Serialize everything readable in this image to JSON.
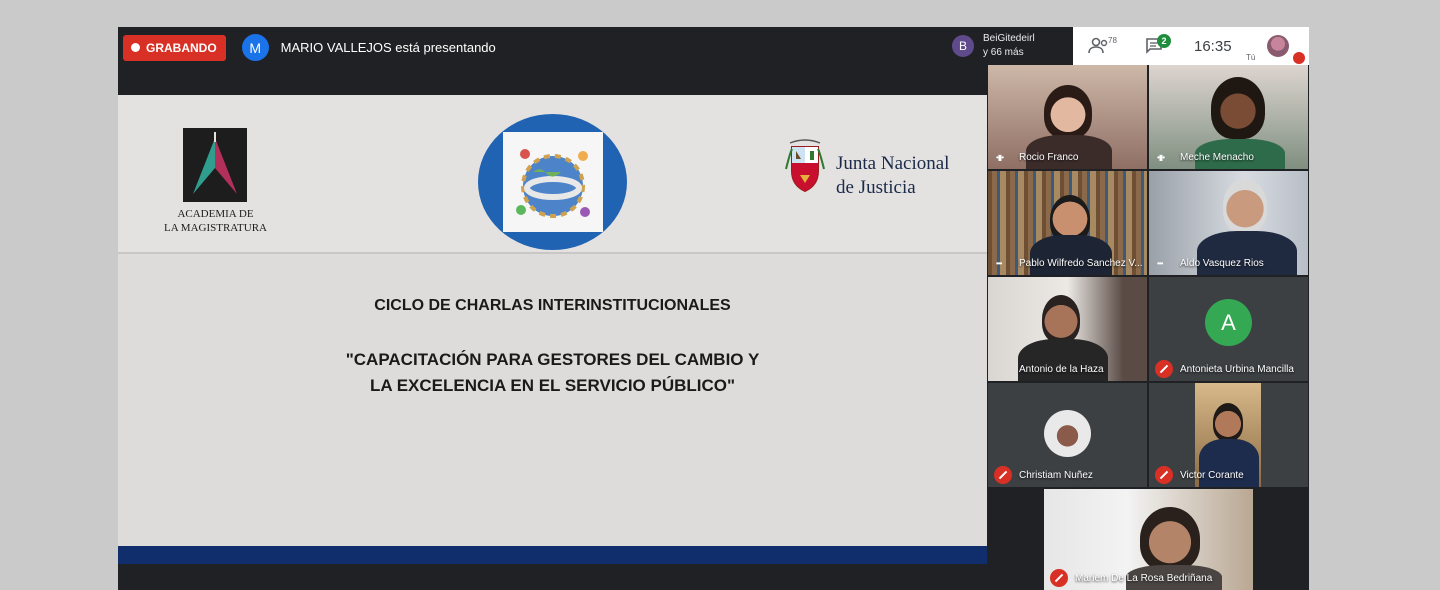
{
  "recording": {
    "label": "GRABANDO"
  },
  "presenter": {
    "initial": "M",
    "text": "MARIO VALLEJOS está presentando"
  },
  "notification": {
    "initial": "B",
    "line1": "BeiGitedeirl",
    "line2": "y 66 más"
  },
  "controls": {
    "people_count": "78",
    "chat_badge": "2",
    "time": "16:35",
    "self_label": "Tú"
  },
  "slide": {
    "left_logo_lines": [
      "ACADEMIA DE",
      "LA MAGISTRATURA"
    ],
    "right_logo_lines": [
      "Junta Nacional",
      "de Justicia"
    ],
    "title": "CICLO DE CHARLAS INTERINSTITUCIONALES",
    "subtitle_line1": "\"CAPACITACIÓN PARA GESTORES DEL CAMBIO  Y",
    "subtitle_line2": "LA EXCELENCIA EN EL SERVICIO PÚBLICO\""
  },
  "participants": [
    {
      "name": "Rocio Franco",
      "state": "talking"
    },
    {
      "name": "Meche Menacho",
      "state": "talking"
    },
    {
      "name": "Pablo Wilfredo Sanchez V...",
      "state": "talking"
    },
    {
      "name": "Aldo Vasquez Rios",
      "state": "talking"
    },
    {
      "name": "Antonio de la Haza",
      "state": "none"
    },
    {
      "name": "Antonieta Urbina Mancilla",
      "state": "muted",
      "initial": "A"
    },
    {
      "name": "Christiam Nuñez",
      "state": "muted"
    },
    {
      "name": "Victor Corante",
      "state": "muted"
    },
    {
      "name": "Mariem De La Rosa Bedriñana",
      "state": "muted"
    }
  ],
  "colors": {
    "record": "#d93025",
    "accent_blue": "#1a73e8",
    "meet_dark": "#202124",
    "slide_bar": "#0f2e6b"
  }
}
